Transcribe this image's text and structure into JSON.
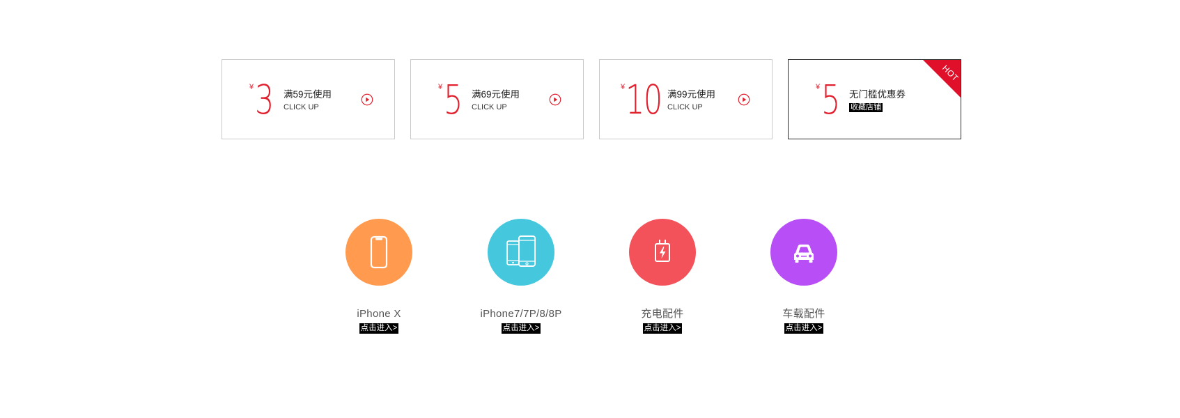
{
  "colors": {
    "accent_red": "#e2202e",
    "hot_ribbon": "#e0102a",
    "circle_orange": "#ff9a4e",
    "circle_cyan": "#45c8de",
    "circle_red": "#f4525a",
    "circle_purple": "#b84ef5"
  },
  "coupons": [
    {
      "currency": "¥",
      "amount": "3",
      "condition": "满59元使用",
      "sub": "CLICK UP",
      "icon": "play-circle-icon"
    },
    {
      "currency": "¥",
      "amount": "5",
      "condition": "满69元使用",
      "sub": "CLICK UP",
      "icon": "play-circle-icon"
    },
    {
      "currency": "¥",
      "amount": "10",
      "condition": "满99元使用",
      "sub": "CLICK UP",
      "icon": "play-circle-icon"
    },
    {
      "currency": "¥",
      "amount": "5",
      "condition": "无门槛优惠券",
      "sub": "收藏店铺",
      "ribbon": "HOT"
    }
  ],
  "categories": [
    {
      "label": "iPhone X",
      "enter": "点击进入>",
      "icon": "iphone-x-icon"
    },
    {
      "label": "iPhone7/7P/8/8P",
      "enter": "点击进入>",
      "icon": "two-phones-icon"
    },
    {
      "label": "充电配件",
      "enter": "点击进入>",
      "icon": "charger-icon"
    },
    {
      "label": "车载配件",
      "enter": "点击进入>",
      "icon": "car-icon"
    }
  ]
}
